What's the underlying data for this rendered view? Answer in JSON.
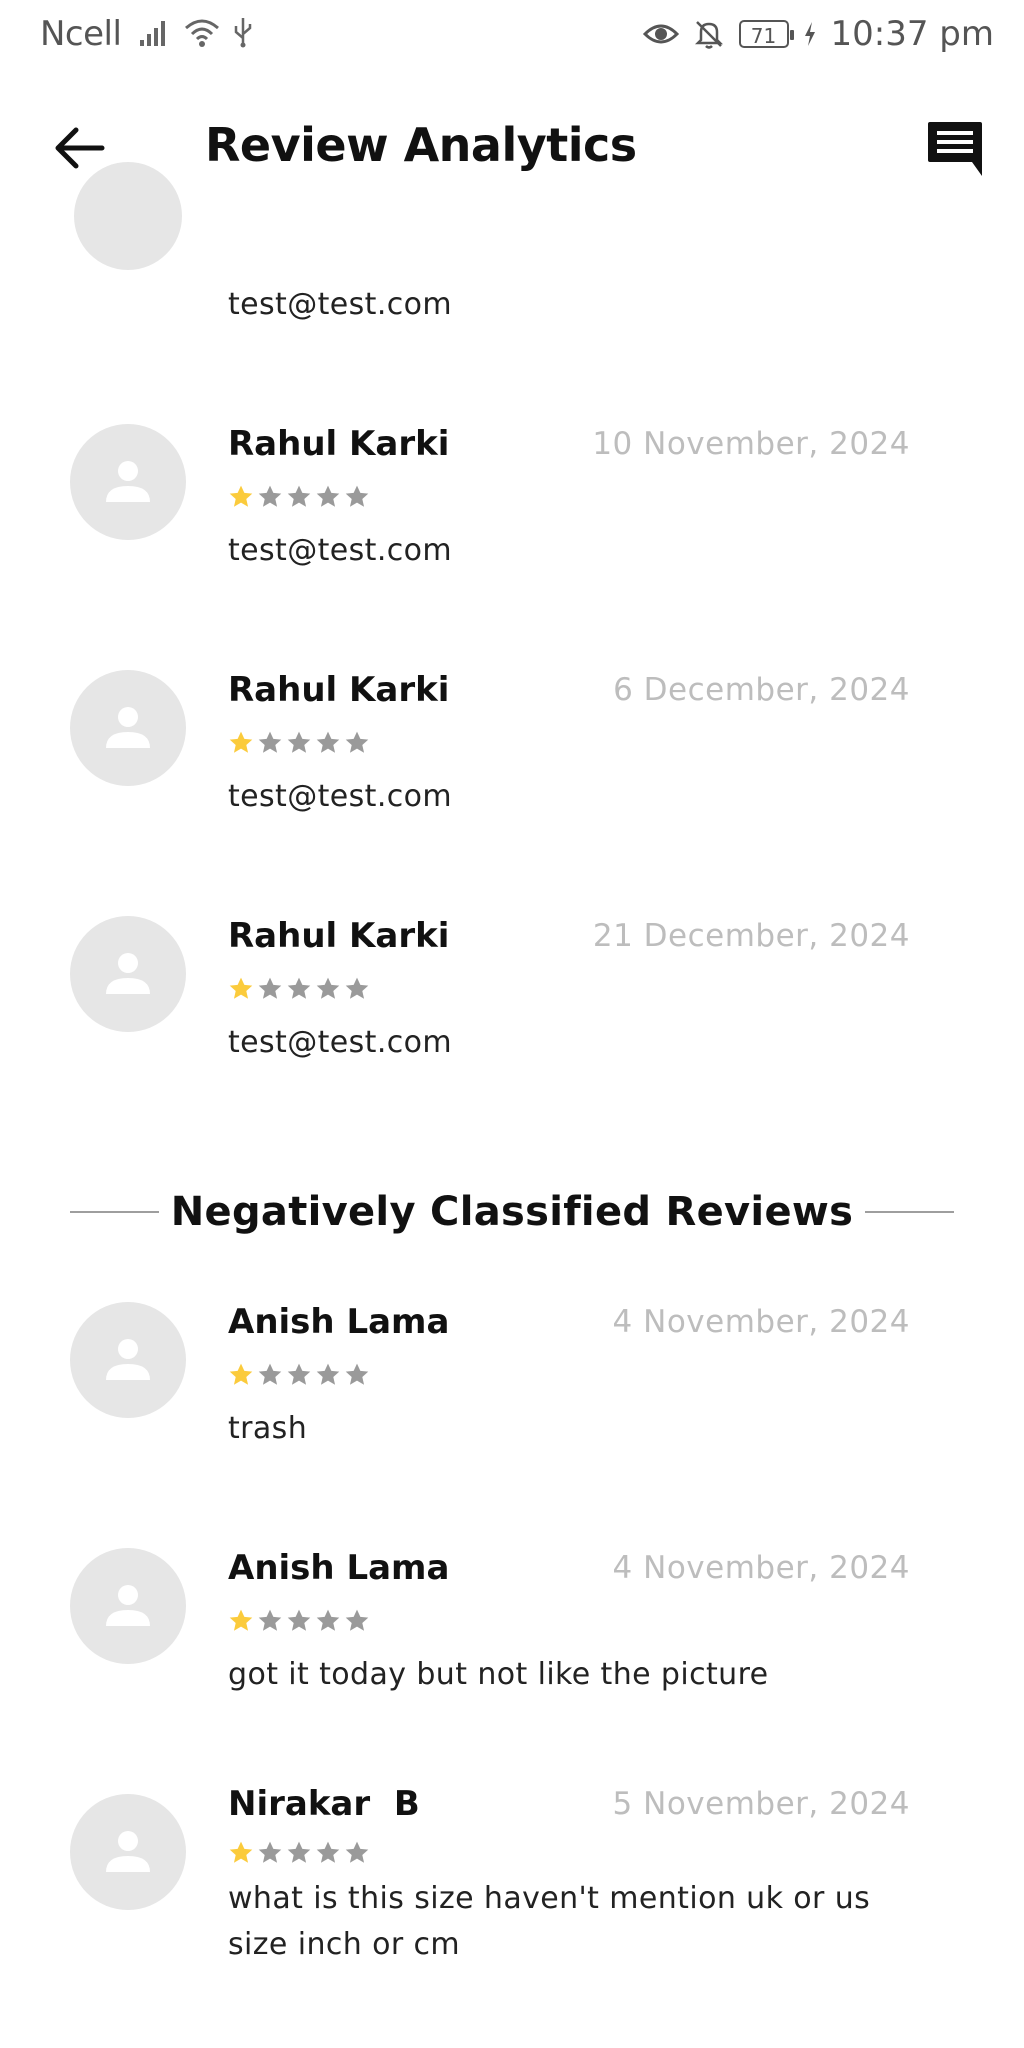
{
  "status_bar": {
    "carrier": "Ncell",
    "battery": "71",
    "time": "10:37 pm"
  },
  "app_bar": {
    "title": "Review Analytics"
  },
  "partial_review": {
    "text": "test@test.com"
  },
  "positive_reviews": [
    {
      "name": "Rahul Karki",
      "date": "10 November, 2024",
      "rating": 1,
      "text": "test@test.com"
    },
    {
      "name": "Rahul Karki",
      "date": "6 December, 2024",
      "rating": 1,
      "text": "test@test.com"
    },
    {
      "name": "Rahul Karki",
      "date": "21 December, 2024",
      "rating": 1,
      "text": "test@test.com"
    }
  ],
  "negative_section": {
    "title": "Negatively Classified Reviews"
  },
  "negative_reviews": [
    {
      "name": "Anish Lama",
      "date": "4 November, 2024",
      "rating": 1,
      "text": "got it today but not like the picture"
    },
    {
      "name": "Anish Lama",
      "date": "4 November, 2024",
      "rating": 1,
      "text": "trash"
    },
    {
      "name": "Nirakar  B",
      "date": "5 November, 2024",
      "rating": 1,
      "text": "what is this size haven't mention uk or us size inch or cm"
    }
  ],
  "colors": {
    "star_filled": "#fbcb3c",
    "star_empty": "#9a9a9a",
    "avatar_bg": "#e6e6e6",
    "date_text": "#bdbdbd"
  }
}
